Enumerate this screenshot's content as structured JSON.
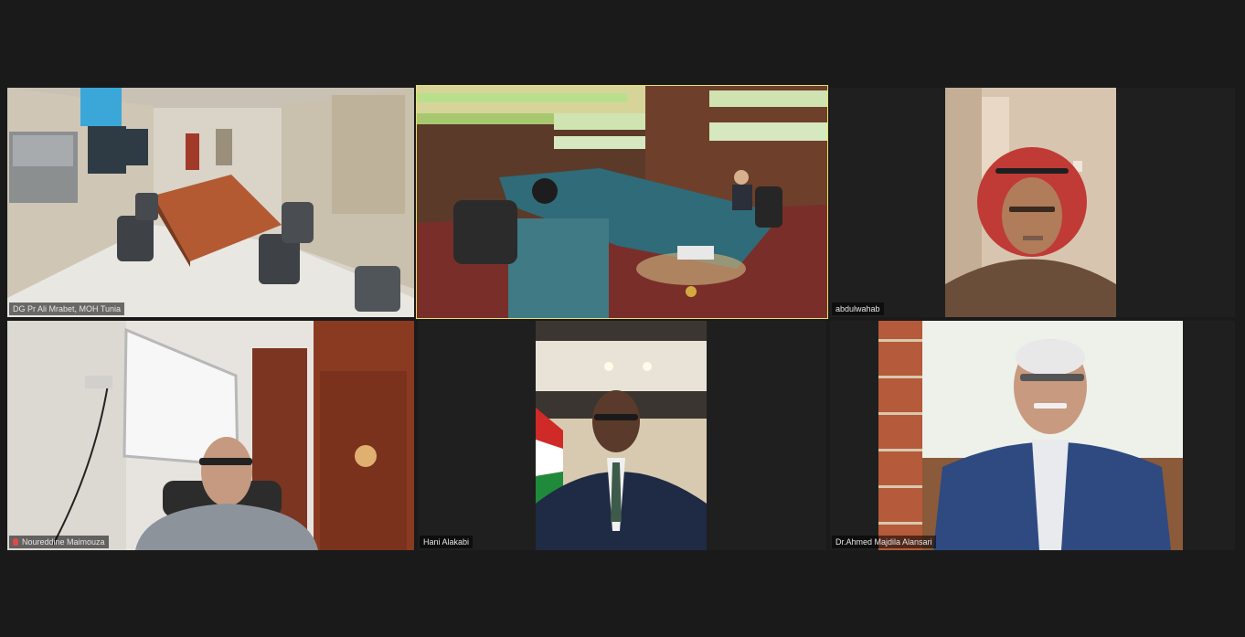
{
  "meeting": {
    "layout": "gallery-view",
    "active_speaker_color": "#e8e06a"
  },
  "participants": [
    {
      "name": "DG Pr Ali Mrabet, MOH Tunia",
      "muted": false,
      "scene": "control-room"
    },
    {
      "name": "",
      "muted": false,
      "scene": "conference-hall",
      "active_speaker": true
    },
    {
      "name": "abdulwahab",
      "muted": false,
      "scene": "man-red-keffiyeh"
    },
    {
      "name": "Noureddine Maimouza",
      "muted": true,
      "scene": "office-whiteboard"
    },
    {
      "name": "Hani Alakabi",
      "muted": false,
      "scene": "man-suit-flag"
    },
    {
      "name": "Dr.Ahmed Majdila Alansari",
      "muted": false,
      "scene": "man-blue-blazer"
    }
  ]
}
